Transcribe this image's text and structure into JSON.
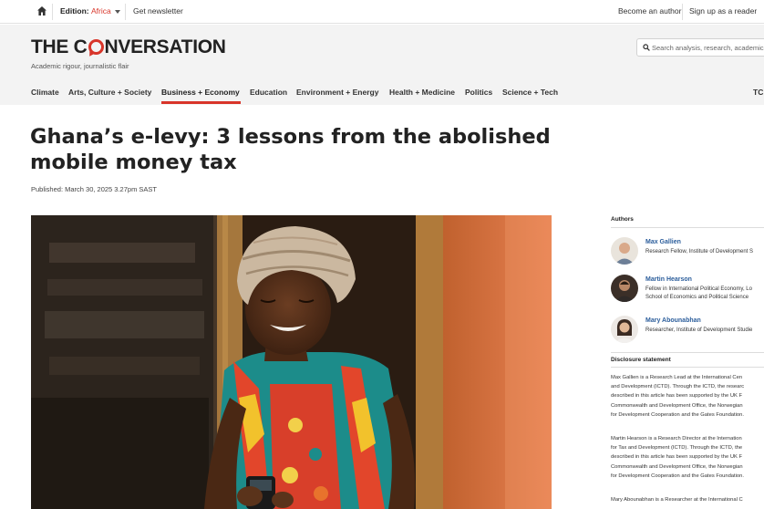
{
  "topbar": {
    "edition_label": "Edition:",
    "edition_value": "Africa",
    "newsletter": "Get newsletter",
    "become_author": "Become an author",
    "signup": "Sign up as a reader"
  },
  "masthead": {
    "logo_left": "THE C",
    "logo_right": "NVERSATION",
    "tagline": "Academic rigour, journalistic flair",
    "search_placeholder": "Search analysis, research, academics…"
  },
  "nav": {
    "items": [
      "Climate",
      "Arts, Culture + Society",
      "Business + Economy",
      "Education",
      "Environment + Energy",
      "Health + Medicine",
      "Politics",
      "Science + Tech"
    ],
    "active_index": 2,
    "overflow_label": "TC"
  },
  "article": {
    "headline_line1": "Ghana’s e-levy: 3 lessons from the abolished",
    "headline_line2": "mobile money tax",
    "published": "Published: March 30, 2025 3.27pm SAST"
  },
  "sidebar": {
    "authors_heading": "Authors",
    "authors": [
      {
        "name": "Max Gallien",
        "role_line1": "Research Fellow, Institute of Development S",
        "role_line2": ""
      },
      {
        "name": "Martin Hearson",
        "role_line1": "Fellow in International Political Economy, Lo",
        "role_line2": "School of Economics and Political Science"
      },
      {
        "name": "Mary Abounabhan",
        "role_line1": "Researcher, Institute of Development Studie",
        "role_line2": ""
      }
    ],
    "disclosure_heading": "Disclosure statement",
    "disclosure_para1": [
      "Max Gallien is a Research Lead at the International Cen",
      "and Development (ICTD). Through the ICTD, the researc",
      "described in this article has been supported by the UK F",
      "Commonwealth and Development Office, the Norwegian",
      "for Development Cooperation and the Gates Foundation."
    ],
    "disclosure_para2": [
      "Martin Hearson is a Research Director at the Internation",
      "for Tax and Development (ICTD). Through the ICTD, the",
      "described in this article has been supported by the UK F",
      "Commonwealth and Development Office, the Norwegian",
      "for Development Cooperation and the Gates Foundation."
    ],
    "disclosure_para3": [
      "Mary Abounabhan is a Researcher at the International C"
    ]
  },
  "colors": {
    "brand_red": "#d8352a",
    "link_blue": "#2b5d9b",
    "masthead_bg": "#f3f3f3"
  },
  "icons": {
    "home": "home-icon",
    "caret": "chevron-down-icon",
    "search": "search-icon"
  }
}
